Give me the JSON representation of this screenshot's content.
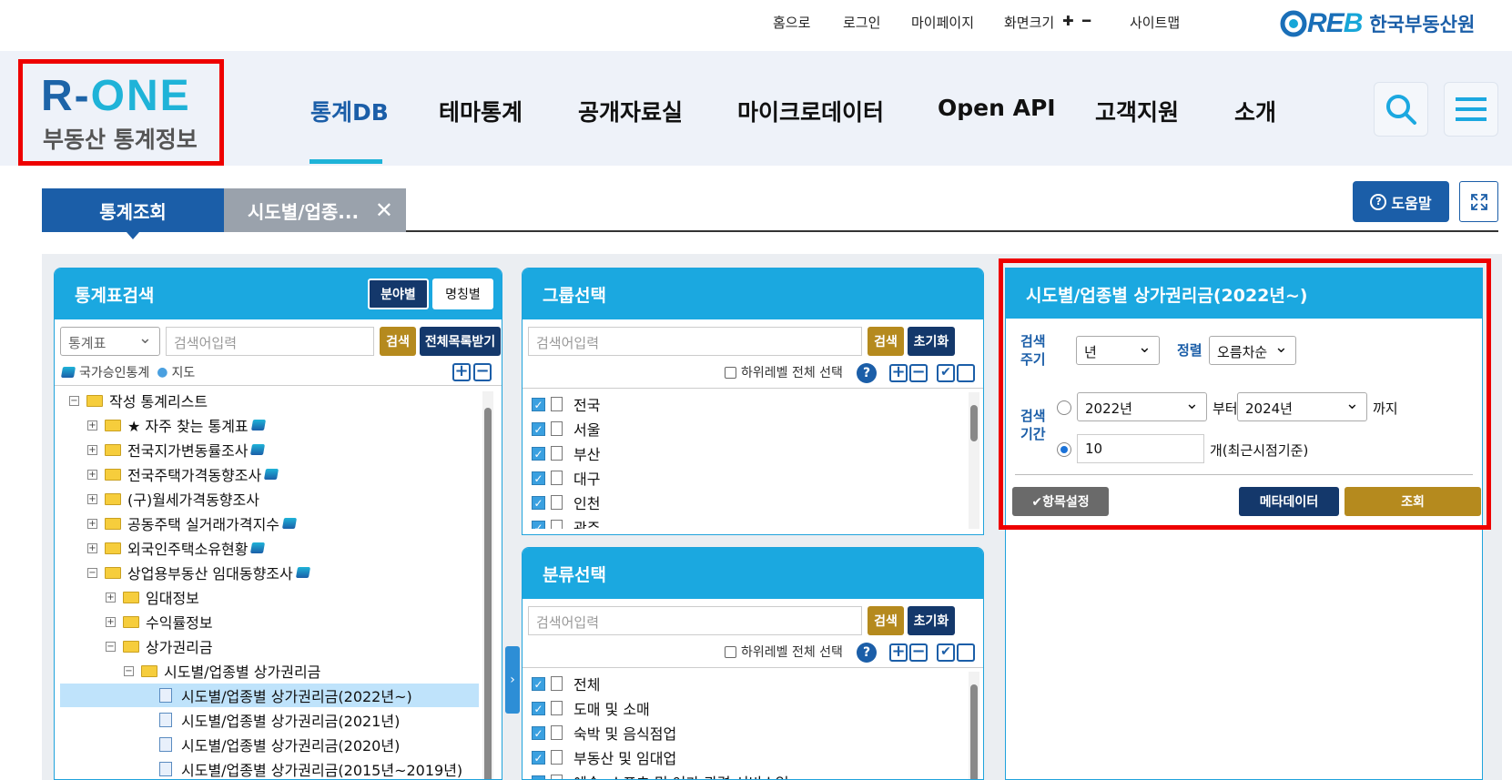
{
  "util": {
    "home": "홈으로",
    "login": "로그인",
    "mypage": "마이페이지",
    "zoom": "화면크기",
    "zoom_in": "✚",
    "zoom_out": "━",
    "sitemap": "사이트맵",
    "reb_mark_a": "RE",
    "reb_mark_b": "B",
    "reb_name": "한국부동산원"
  },
  "logo": {
    "main_a": "R-",
    "main_b": "ONE",
    "sub": "부동산 통계정보"
  },
  "menu": [
    "통계DB",
    "테마통계",
    "공개자료실",
    "마이크로데이터",
    "Open API",
    "고객지원",
    "소개"
  ],
  "tabs": {
    "tab1": "통계조회",
    "tab2": "시도별/업종...",
    "close": "✕"
  },
  "help": {
    "label": "도움말",
    "q": "?"
  },
  "left": {
    "title": "통계표검색",
    "btn_field": "분야별",
    "btn_name": "명칭별",
    "select": "통계표",
    "placeholder": "검색어입력",
    "search": "검색",
    "download": "전체목록받기",
    "legend1": "국가승인통계",
    "legend2": "지도",
    "tree": [
      {
        "t": "작성 통계리스트",
        "lv": 0,
        "ex": "−",
        "k": "folder"
      },
      {
        "t": "★ 자주 찾는 통계표",
        "lv": 1,
        "ex": "+",
        "k": "folder",
        "s": true
      },
      {
        "t": "전국지가변동률조사",
        "lv": 1,
        "ex": "+",
        "k": "folder",
        "s": true
      },
      {
        "t": "전국주택가격동향조사",
        "lv": 1,
        "ex": "+",
        "k": "folder",
        "s": true
      },
      {
        "t": "(구)월세가격동향조사",
        "lv": 1,
        "ex": "+",
        "k": "folder"
      },
      {
        "t": "공동주택 실거래가격지수",
        "lv": 1,
        "ex": "+",
        "k": "folder",
        "s": true
      },
      {
        "t": "외국인주택소유현황",
        "lv": 1,
        "ex": "+",
        "k": "folder",
        "s": true
      },
      {
        "t": "상업용부동산 임대동향조사",
        "lv": 1,
        "ex": "−",
        "k": "folder",
        "s": true
      },
      {
        "t": "임대정보",
        "lv": 2,
        "ex": "+",
        "k": "folder"
      },
      {
        "t": "수익률정보",
        "lv": 2,
        "ex": "+",
        "k": "folder"
      },
      {
        "t": "상가권리금",
        "lv": 2,
        "ex": "−",
        "k": "folder"
      },
      {
        "t": "시도별/업종별 상가권리금",
        "lv": 3,
        "ex": "−",
        "k": "folder"
      },
      {
        "t": "시도별/업종별 상가권리금(2022년~)",
        "lv": 4,
        "k": "table",
        "sel": true
      },
      {
        "t": "시도별/업종별 상가권리금(2021년)",
        "lv": 4,
        "k": "table"
      },
      {
        "t": "시도별/업종별 상가권리금(2020년)",
        "lv": 4,
        "k": "table"
      },
      {
        "t": "시도별/업종별 상가권리금(2015년~2019년)",
        "lv": 4,
        "k": "table"
      }
    ]
  },
  "group": {
    "title": "그룹선택",
    "placeholder": "검색어입력",
    "search": "검색",
    "reset": "초기화",
    "sublevel": "하위레벨 전체 선택",
    "items": [
      "전국",
      "서울",
      "부산",
      "대구",
      "인천",
      "광주"
    ]
  },
  "cls": {
    "title": "분류선택",
    "placeholder": "검색어입력",
    "search": "검색",
    "reset": "초기화",
    "sublevel": "하위레벨 전체 선택",
    "items": [
      "전체",
      "도매 및 소매",
      "숙박 및 음식점업",
      "부동산 및 임대업",
      "예술, 스포츠 및 여가 관련 서비스업"
    ]
  },
  "right": {
    "title": "시도별/업종별 상가권리금(2022년~)",
    "cycle_label": "검색\n주기",
    "cycle": "년",
    "sort_label": "정렬",
    "sort": "오름차순",
    "period_label": "검색\n기간",
    "from": "2022년",
    "from_suffix": "부터",
    "to": "2024년",
    "to_suffix": "까지",
    "count": "10",
    "count_suffix": "개(최근시점기준)",
    "items_btn": "✔항목설정",
    "meta_btn": "메타데이터",
    "query_btn": "조회"
  },
  "colors": {
    "accent": "#1ba8e0",
    "navy": "#1b5ea8",
    "gold": "#b58a1e",
    "highlight": "#e00000"
  }
}
